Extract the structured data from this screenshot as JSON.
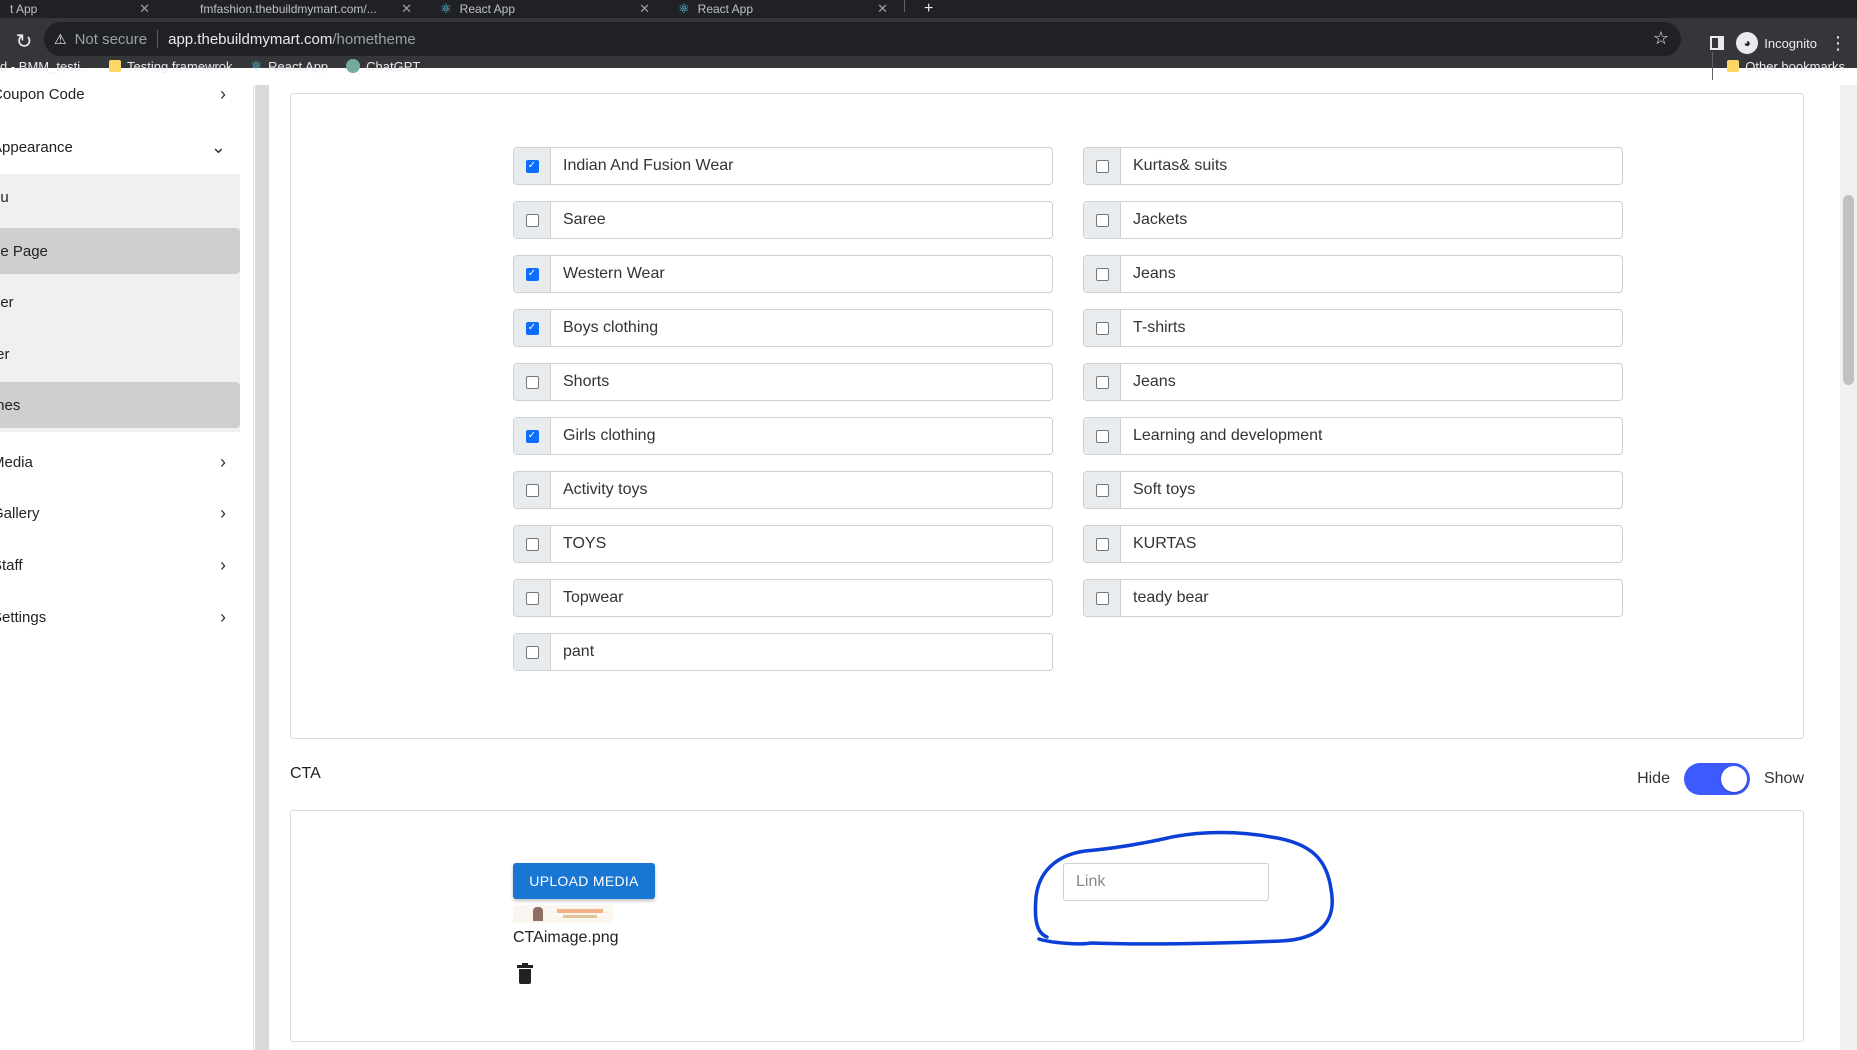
{
  "browser": {
    "tabs": [
      {
        "title": "t App"
      },
      {
        "title": "fmfashion.thebuildmymart.com/..."
      },
      {
        "title": "React App"
      },
      {
        "title": "React App"
      }
    ],
    "security_label": "Not secure",
    "url_host": "app.thebuildmymart.com",
    "url_path": "/hometheme",
    "profile_label": "Incognito",
    "bookmarks": [
      {
        "label": "d - BMM_testi...",
        "icon": "folder-icon"
      },
      {
        "label": "Testing framewrok",
        "icon": "folder-icon"
      },
      {
        "label": "React App",
        "icon": "react-icon"
      },
      {
        "label": "ChatGPT",
        "icon": "chatgpt-icon"
      }
    ],
    "other_bookmarks": "Other bookmarks"
  },
  "sidebar": {
    "items": [
      {
        "label": "Coupon Code",
        "chevron": "right"
      },
      {
        "label": "Appearance",
        "chevron": "down"
      }
    ],
    "submenu": [
      {
        "label": "nu",
        "active": false
      },
      {
        "label": "ne Page",
        "active": true
      },
      {
        "label": "der",
        "active": false
      },
      {
        "label": "ter",
        "active": false
      },
      {
        "label": "mes",
        "active": true
      }
    ],
    "lower_items": [
      {
        "label": "Media",
        "chevron": "right"
      },
      {
        "label": "Gallery",
        "chevron": "right"
      },
      {
        "label": "Staff",
        "chevron": "right"
      },
      {
        "label": "Settings",
        "chevron": "right"
      }
    ]
  },
  "categories": {
    "left": [
      {
        "label": "Indian And Fusion Wear",
        "checked": true
      },
      {
        "label": "Saree",
        "checked": false
      },
      {
        "label": "Western Wear",
        "checked": true
      },
      {
        "label": "Boys clothing",
        "checked": true
      },
      {
        "label": "Shorts",
        "checked": false
      },
      {
        "label": "Girls clothing",
        "checked": true
      },
      {
        "label": "Activity toys",
        "checked": false
      },
      {
        "label": "TOYS",
        "checked": false
      },
      {
        "label": "Topwear",
        "checked": false
      },
      {
        "label": "pant",
        "checked": false
      }
    ],
    "right": [
      {
        "label": "Kurtas& suits",
        "checked": false
      },
      {
        "label": "Jackets",
        "checked": false
      },
      {
        "label": "Jeans",
        "checked": false
      },
      {
        "label": "T-shirts",
        "checked": false
      },
      {
        "label": "Jeans",
        "checked": false
      },
      {
        "label": "Learning and development",
        "checked": false
      },
      {
        "label": "Soft toys",
        "checked": false
      },
      {
        "label": "KURTAS",
        "checked": false
      },
      {
        "label": "teady bear",
        "checked": false
      }
    ]
  },
  "cta": {
    "title": "CTA",
    "toggle_off_label": "Hide",
    "toggle_on_label": "Show",
    "toggle_on": true,
    "upload_button": "UPLOAD MEDIA",
    "file_name": "CTAimage.png",
    "link_placeholder": "Link",
    "link_value": ""
  },
  "colors": {
    "accent": "#1976d2",
    "toggle": "#3d5afe",
    "checkbox": "#0d6efd",
    "annotation": "#0b3fd6"
  }
}
